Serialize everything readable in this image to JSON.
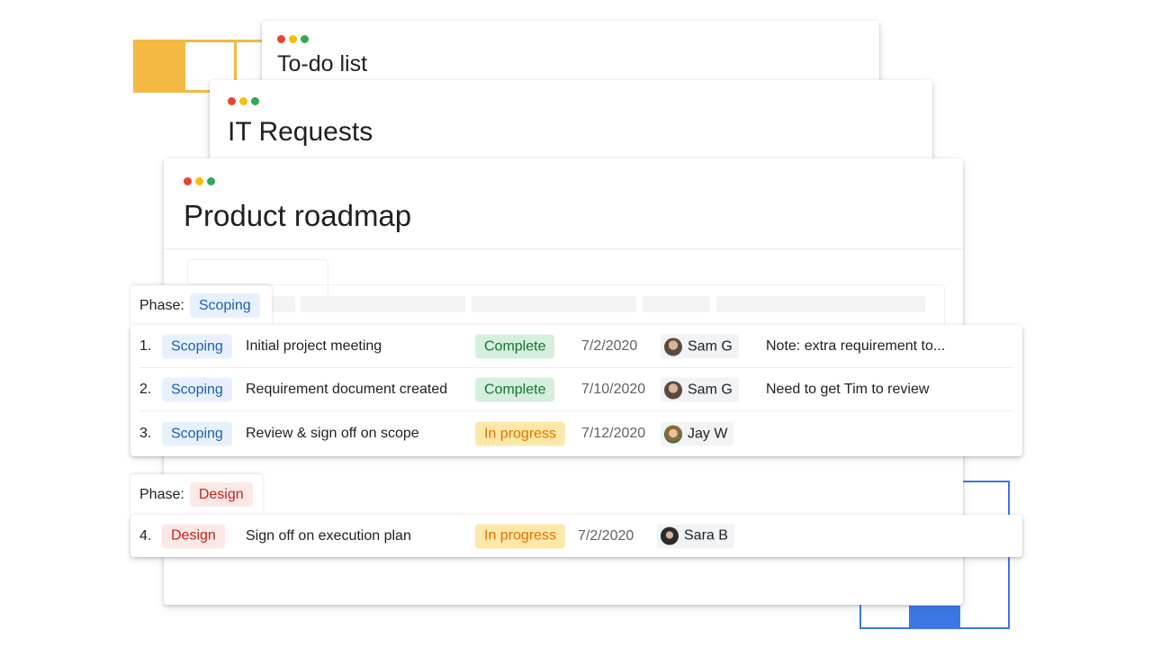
{
  "windows": {
    "todo": {
      "title": "To-do list"
    },
    "it_requests": {
      "title": "IT Requests"
    },
    "roadmap": {
      "title": "Product roadmap"
    }
  },
  "colors": {
    "accent_yellow": "#f4b942",
    "accent_blue": "#3b78e7",
    "dot_red": "#ea4335",
    "dot_yellow": "#fbbc04",
    "dot_green": "#34a853"
  },
  "groups": [
    {
      "label": "Phase:",
      "phase": "Scoping",
      "rows": [
        {
          "num": "1.",
          "phase": "Scoping",
          "task": "Initial project meeting",
          "status": "Complete",
          "date": "7/2/2020",
          "owner": "Sam G",
          "note": "Note: extra requirement to..."
        },
        {
          "num": "2.",
          "phase": "Scoping",
          "task": "Requirement document created",
          "status": "Complete",
          "date": "7/10/2020",
          "owner": "Sam G",
          "note": "Need to get Tim to review"
        },
        {
          "num": "3.",
          "phase": "Scoping",
          "task": "Review & sign off on scope",
          "status": "In progress",
          "date": "7/12/2020",
          "owner": "Jay W",
          "note": ""
        }
      ]
    },
    {
      "label": "Phase:",
      "phase": "Design",
      "rows": [
        {
          "num": "4.",
          "phase": "Design",
          "task": "Sign off on execution plan",
          "status": "In progress",
          "date": "7/2/2020",
          "owner": "Sara B",
          "note": ""
        }
      ]
    }
  ]
}
